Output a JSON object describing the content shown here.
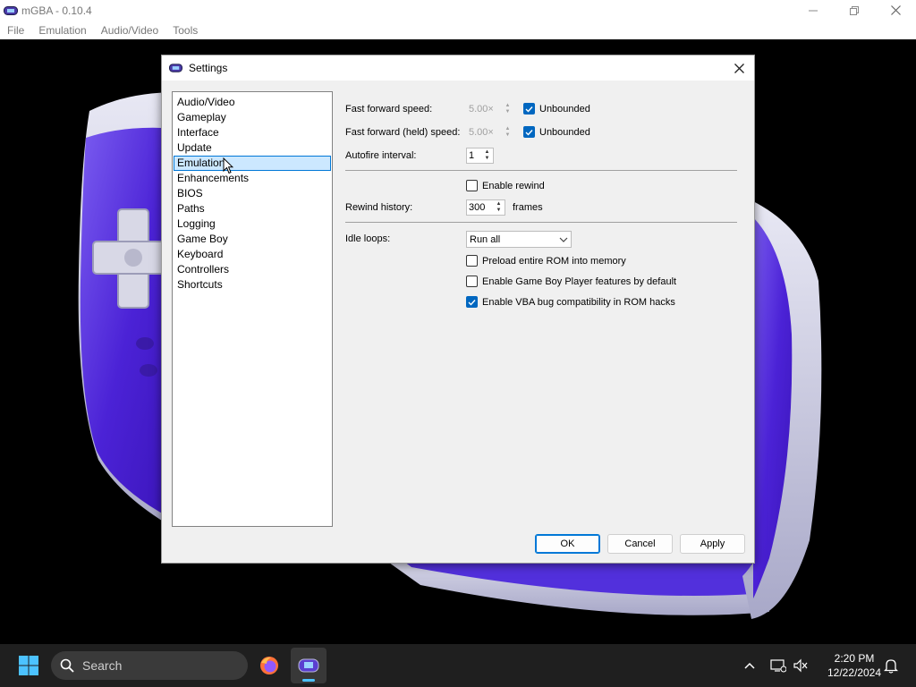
{
  "window": {
    "title": "mGBA - 0.10.4",
    "controls": [
      "minimize-icon",
      "restore-icon",
      "close-icon"
    ]
  },
  "menubar": {
    "items": [
      "File",
      "Emulation",
      "Audio/Video",
      "Tools"
    ]
  },
  "dialog": {
    "title": "Settings",
    "categories": [
      "Audio/Video",
      "Gameplay",
      "Interface",
      "Update",
      "Emulation",
      "Enhancements",
      "BIOS",
      "Paths",
      "Logging",
      "Game Boy",
      "Keyboard",
      "Controllers",
      "Shortcuts"
    ],
    "selected_category": "Emulation",
    "emulation": {
      "ff_speed_label": "Fast forward speed:",
      "ff_speed_value": "5.00×",
      "ff_unbounded_label": "Unbounded",
      "ff_unbounded_checked": true,
      "ffh_speed_label": "Fast forward (held) speed:",
      "ffh_speed_value": "5.00×",
      "ffh_unbounded_label": "Unbounded",
      "ffh_unbounded_checked": true,
      "autofire_label": "Autofire interval:",
      "autofire_value": "1",
      "enable_rewind_label": "Enable rewind",
      "enable_rewind_checked": false,
      "rewind_history_label": "Rewind history:",
      "rewind_history_value": "300",
      "rewind_history_unit": "frames",
      "idle_loops_label": "Idle loops:",
      "idle_loops_value": "Run all",
      "preload_rom_label": "Preload entire ROM into memory",
      "preload_rom_checked": false,
      "gb_player_label": "Enable Game Boy Player features by default",
      "gb_player_checked": false,
      "vba_bug_label": "Enable VBA bug compatibility in ROM hacks",
      "vba_bug_checked": true
    },
    "buttons": {
      "ok": "OK",
      "cancel": "Cancel",
      "apply": "Apply"
    }
  },
  "taskbar": {
    "search_placeholder": "Search",
    "apps": [
      "firefox-icon",
      "mgba-icon"
    ],
    "active_app": "mgba-icon",
    "clock_time": "2:20 PM",
    "clock_date": "12/22/2024",
    "tray": [
      "chevron-up-icon",
      "network-icon",
      "volume-muted-icon",
      "notification-bell-icon"
    ]
  },
  "colors": {
    "accent": "#0078d7",
    "checkbox_checked": "#0067c0",
    "selection_bg": "#cce8ff",
    "gba_purple": "#5a2ee0",
    "taskbar_bg": "#1f1f1f"
  }
}
